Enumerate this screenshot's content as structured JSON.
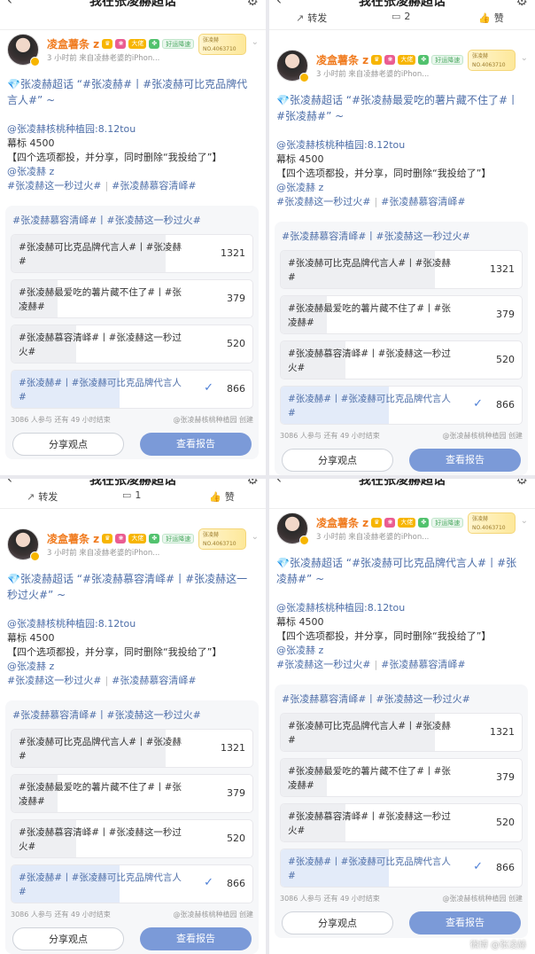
{
  "common": {
    "nav_title": "我在张凌赫超话",
    "username": "凌盒薯条 z",
    "meta": "3 小时前   来自凌赫老婆的iPhon...",
    "badge_fan": "好运降速",
    "badge_vip": "大佬",
    "medal_name": "张凌赫",
    "medal_no": "NO.4063710",
    "post_line1": "@张凌赫核桃种植园:8.12tou",
    "post_line2": "幕标 4500",
    "post_line3": "【四个选项都投，并分享，同时删除“我投给了”】",
    "post_line4": "@张凌赫 z",
    "options": [
      {
        "label": "#张凌赫可比克品牌代言人#丨#张凌赫#",
        "count": "1321",
        "share": 0.4
      },
      {
        "label": "#张凌赫最爱吃的薯片藏不住了#丨#张凌赫#",
        "count": "379",
        "share": 0.12
      },
      {
        "label": "#张凌赫慕容清峄#丨#张凌赫这一秒过火#",
        "count": "520",
        "share": 0.17
      },
      {
        "label": "#张凌赫#丨#张凌赫可比克品牌代言人#",
        "count": "866",
        "share": 0.28
      }
    ],
    "vote_stats": "3086 人参与   还有 49 小时结束",
    "creator": "@张凌赫核桃种植园 创建",
    "share_btn": "分享观点",
    "report_btn": "查看报告",
    "repost": "转发",
    "comment_icon_label": "评论",
    "like": "赞",
    "watermark": "微博 @张凌赫"
  },
  "panels": [
    {
      "show_actions": false,
      "comment_count": "",
      "topic_line": "💎张凌赫超话 “#张凌赫#丨#张凌赫可比克品牌代言人#” ~",
      "tags": "#张凌赫这一秒过火#",
      "tags2": "#张凌赫慕容清峄#",
      "vote_title": "#张凌赫慕容清峄#丨#张凌赫这一秒过火#"
    },
    {
      "show_actions": true,
      "comment_count": "2",
      "topic_line": "💎张凌赫超话 “#张凌赫最爱吃的薯片藏不住了#丨#张凌赫#” ~",
      "tags": "#张凌赫这一秒过火#",
      "tags2": "#张凌赫慕容清峄#",
      "vote_title": "#张凌赫慕容清峄#丨#张凌赫这一秒过火#"
    },
    {
      "show_actions": true,
      "comment_count": "1",
      "topic_line": "💎张凌赫超话 “#张凌赫慕容清峄#丨#张凌赫这一秒过火#” ~",
      "tags": "#张凌赫这一秒过火#",
      "tags2": "#张凌赫慕容清峄#",
      "vote_title": "#张凌赫慕容清峄#丨#张凌赫这一秒过火#"
    },
    {
      "show_actions": false,
      "comment_count": "",
      "topic_line": "💎张凌赫超话 “#张凌赫可比克品牌代言人#丨#张凌赫#” ~",
      "tags": "#张凌赫这一秒过火#",
      "tags2": "#张凌赫慕容清峄#",
      "vote_title": "#张凌赫慕容清峄#丨#张凌赫这一秒过火#"
    }
  ]
}
